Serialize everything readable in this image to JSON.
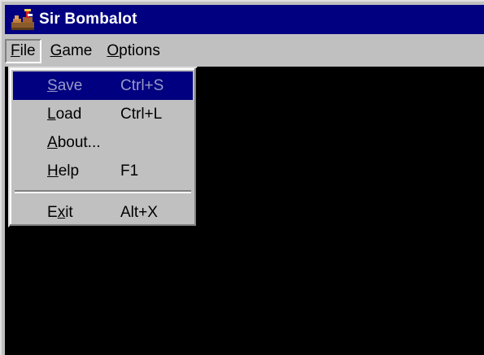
{
  "window": {
    "title": "Sir Bombalot",
    "icon": "sir-bombalot-app-icon"
  },
  "menubar": {
    "items": [
      {
        "mnemonic": "F",
        "rest": "ile",
        "label": "File"
      },
      {
        "mnemonic": "G",
        "rest": "ame",
        "label": "Game"
      },
      {
        "mnemonic": "O",
        "rest": "ptions",
        "label": "Options"
      }
    ],
    "open_menu": "File"
  },
  "file_menu": {
    "items": [
      {
        "mnemonic": "S",
        "rest": "ave",
        "label": "Save",
        "shortcut": "Ctrl+S",
        "enabled": false,
        "highlighted": true
      },
      {
        "mnemonic": "L",
        "rest": "oad",
        "label": "Load",
        "shortcut": "Ctrl+L",
        "enabled": true
      },
      {
        "mnemonic": "A",
        "rest": "bout...",
        "label": "About...",
        "shortcut": "",
        "enabled": true
      },
      {
        "mnemonic": "H",
        "rest": "elp",
        "label": "Help",
        "shortcut": "F1",
        "enabled": true
      },
      {
        "pre": "E",
        "mnemonic": "x",
        "rest": "it",
        "label": "Exit",
        "shortcut": "Alt+X",
        "enabled": true
      }
    ]
  },
  "colors": {
    "title_bar": "#000080",
    "menu_highlight": "#000080",
    "face": "#c0c0c0",
    "game_background": "#000000"
  }
}
